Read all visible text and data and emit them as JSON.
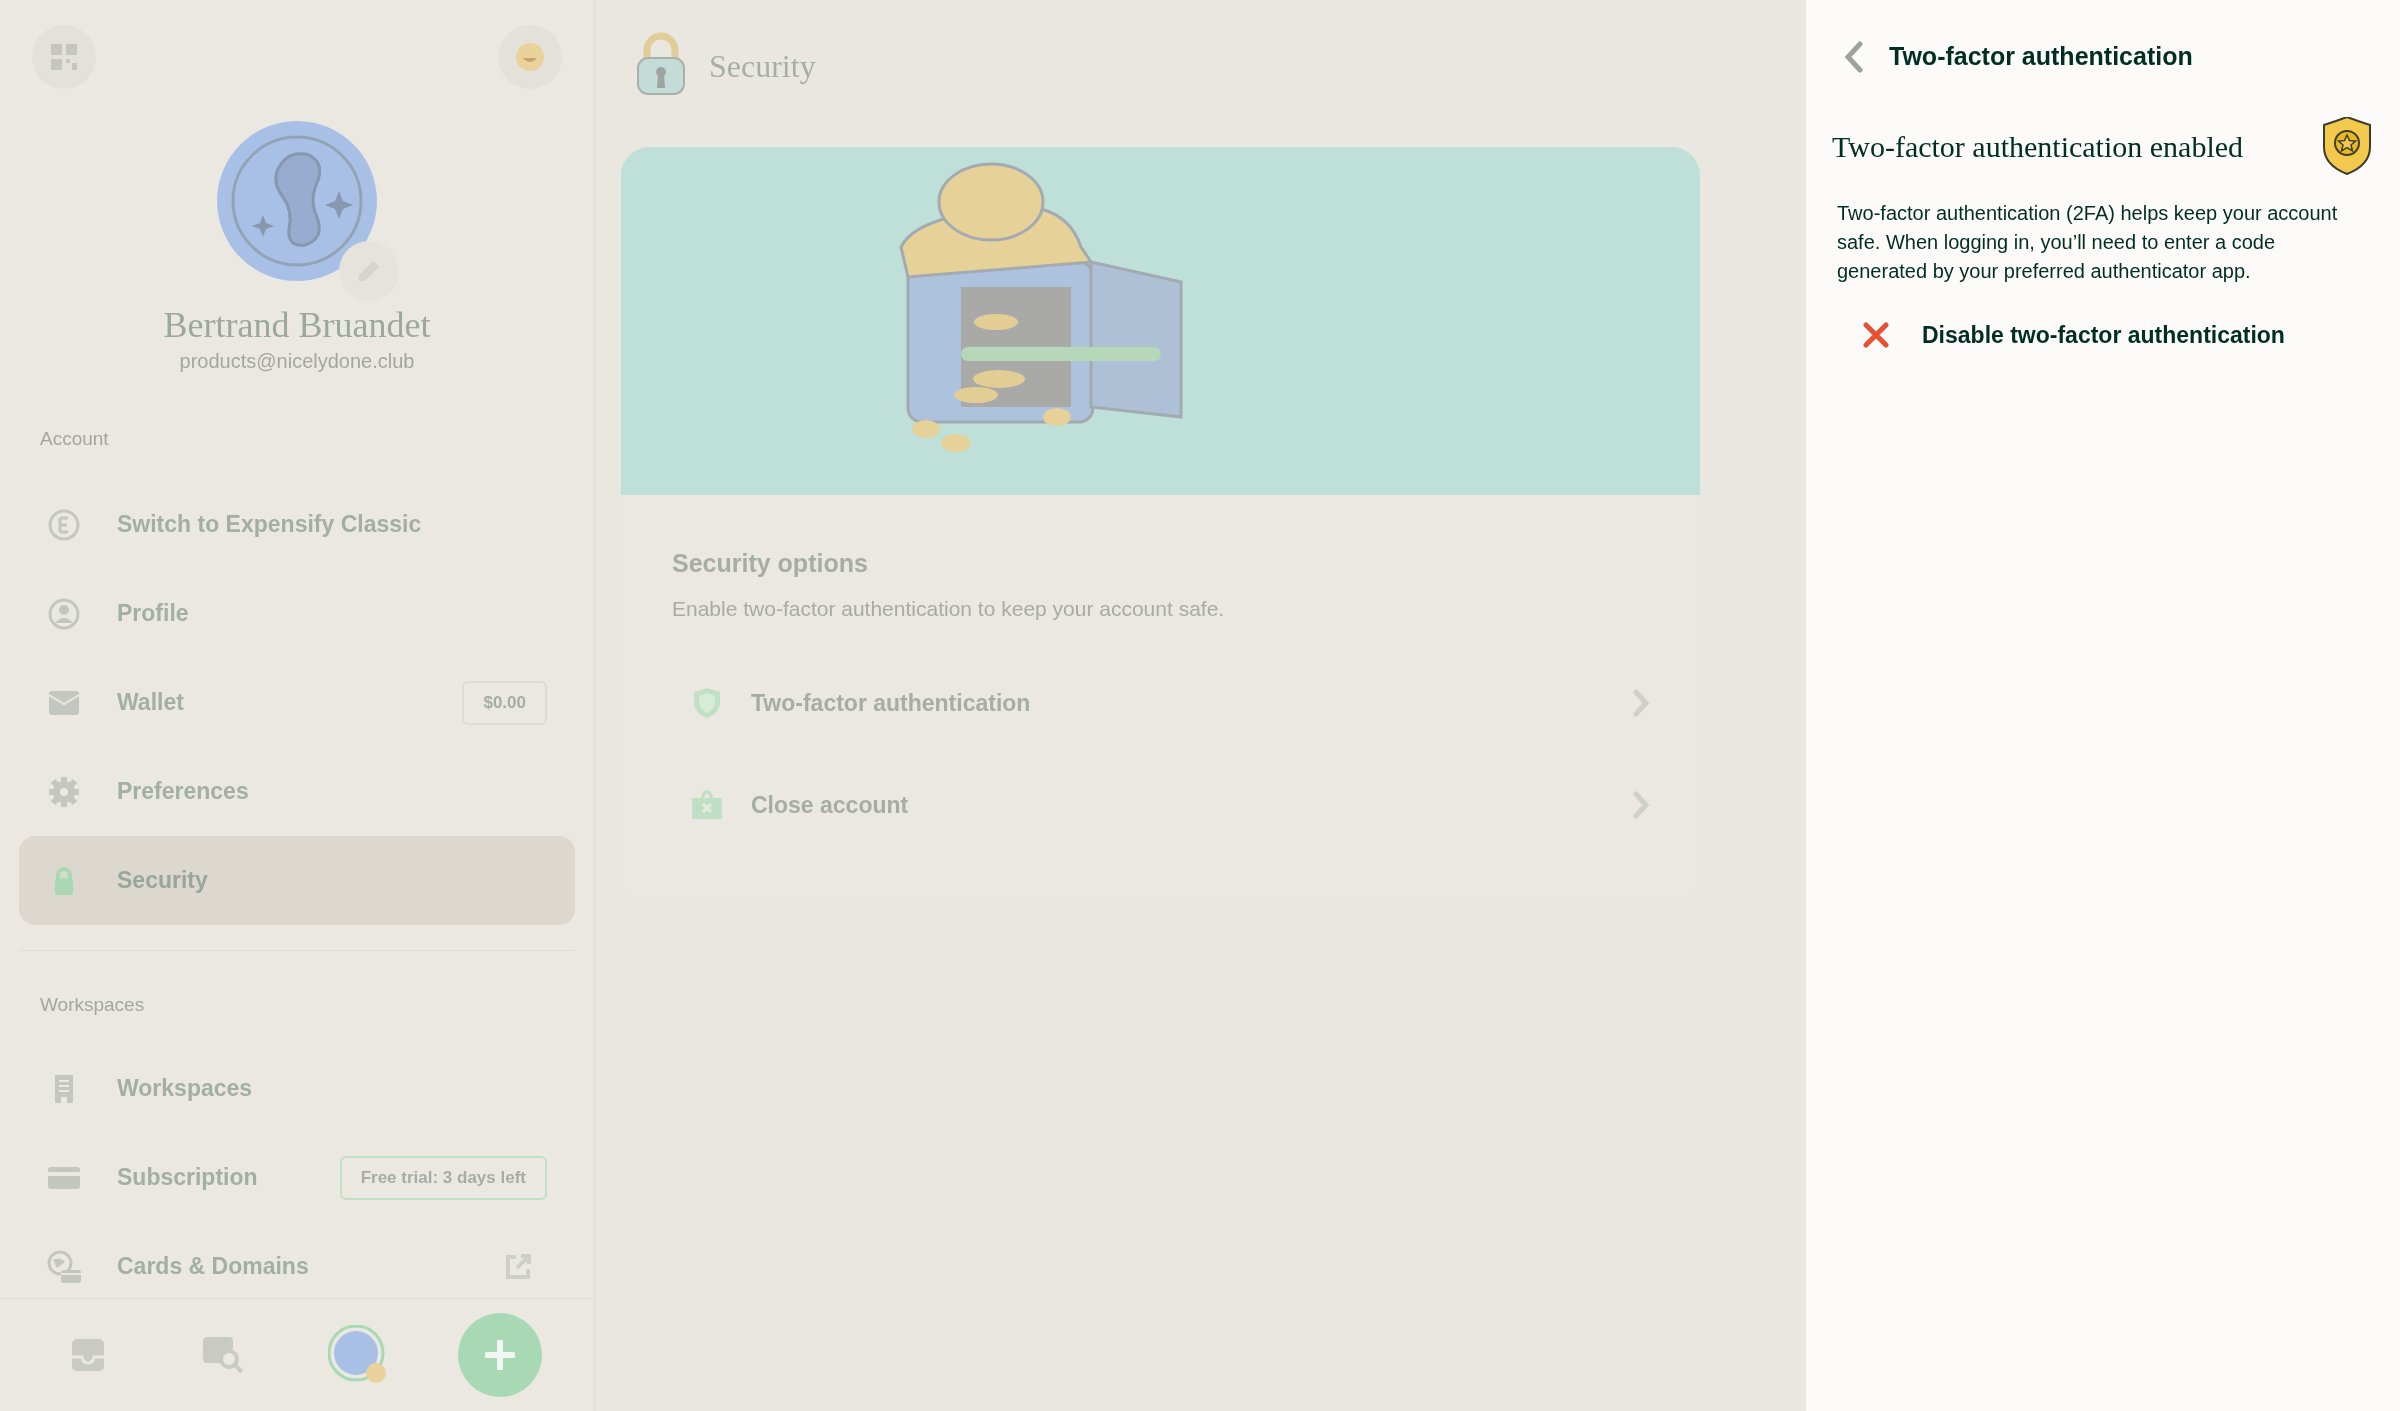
{
  "sidebar": {
    "profile": {
      "name": "Bertrand Bruandet",
      "email": "products@nicelydone.club"
    },
    "sections": [
      {
        "heading": "Account",
        "items": [
          {
            "label": "Switch to Expensify Classic",
            "selected": false
          },
          {
            "label": "Profile",
            "selected": false
          },
          {
            "label": "Wallet",
            "selected": false,
            "badge": {
              "text": "$0.00",
              "kind": "plain"
            }
          },
          {
            "label": "Preferences",
            "selected": false
          },
          {
            "label": "Security",
            "selected": true
          }
        ]
      },
      {
        "heading": "Workspaces",
        "items": [
          {
            "label": "Workspaces",
            "selected": false
          },
          {
            "label": "Subscription",
            "selected": false,
            "badge": {
              "text": "Free trial: 3 days left",
              "kind": "highlight"
            }
          },
          {
            "label": "Cards & Domains",
            "selected": false,
            "external": true
          }
        ]
      }
    ]
  },
  "bottom_nav": [
    {
      "selected": false
    },
    {
      "selected": false
    },
    {
      "selected": true
    }
  ],
  "main": {
    "title": "Security",
    "security_options": {
      "title": "Security options",
      "subtitle": "Enable two-factor authentication to keep your account safe.",
      "rows": [
        {
          "label": "Two-factor authentication"
        },
        {
          "label": "Close account"
        }
      ]
    }
  },
  "panel": {
    "title": "Two-factor authentication",
    "heading": "Two-factor authentication enabled",
    "description": "Two-factor authentication (2FA) helps keep your account safe. When logging in, you’ll need to enter a code generated by your preferred authenticator app.",
    "action": {
      "label": "Disable two-factor authentication"
    }
  }
}
